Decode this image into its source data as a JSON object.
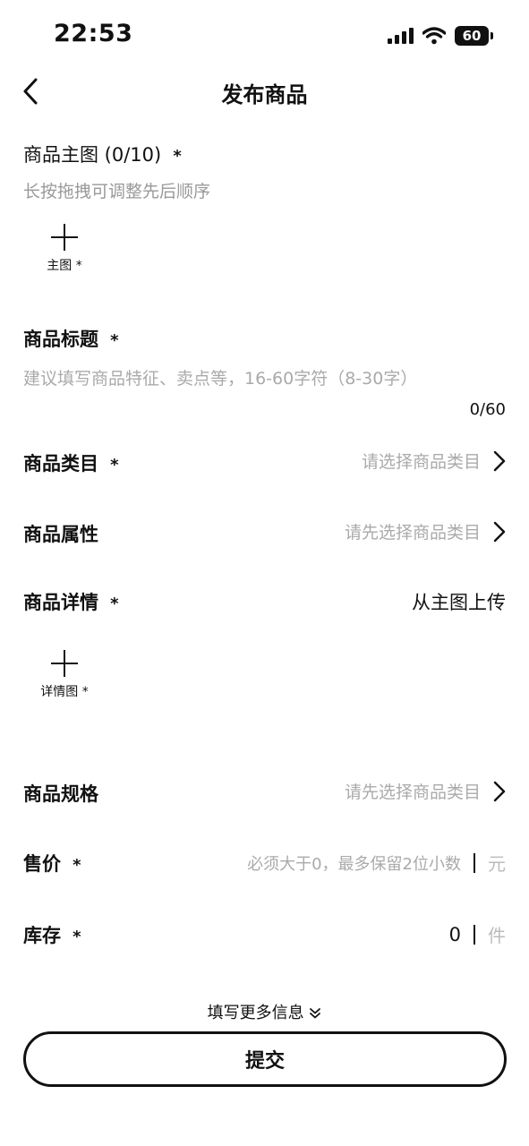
{
  "status_bar": {
    "time": "22:53",
    "battery": "60"
  },
  "header": {
    "title": "发布商品"
  },
  "main_images": {
    "label": "商品主图 (0/10)",
    "required": "*",
    "hint": "长按拖拽可调整先后顺序",
    "tile_label": "主图",
    "tile_required": "*"
  },
  "product_title": {
    "label": "商品标题",
    "required": "*",
    "placeholder": "建议填写商品特征、卖点等，16-60字符（8-30字）",
    "counter": "0/60"
  },
  "category": {
    "label": "商品类目",
    "required": "*",
    "value": "请选择商品类目"
  },
  "attributes": {
    "label": "商品属性",
    "value": "请先选择商品类目"
  },
  "details": {
    "label": "商品详情",
    "required": "*",
    "action": "从主图上传",
    "tile_label": "详情图",
    "tile_required": "*"
  },
  "specs": {
    "label": "商品规格",
    "value": "请先选择商品类目"
  },
  "price": {
    "label": "售价",
    "required": "*",
    "placeholder": "必须大于0，最多保留2位小数",
    "unit": "元"
  },
  "stock": {
    "label": "库存",
    "required": "*",
    "value": "0",
    "unit": "件"
  },
  "footer": {
    "more_info": "填写更多信息",
    "submit": "提交"
  }
}
